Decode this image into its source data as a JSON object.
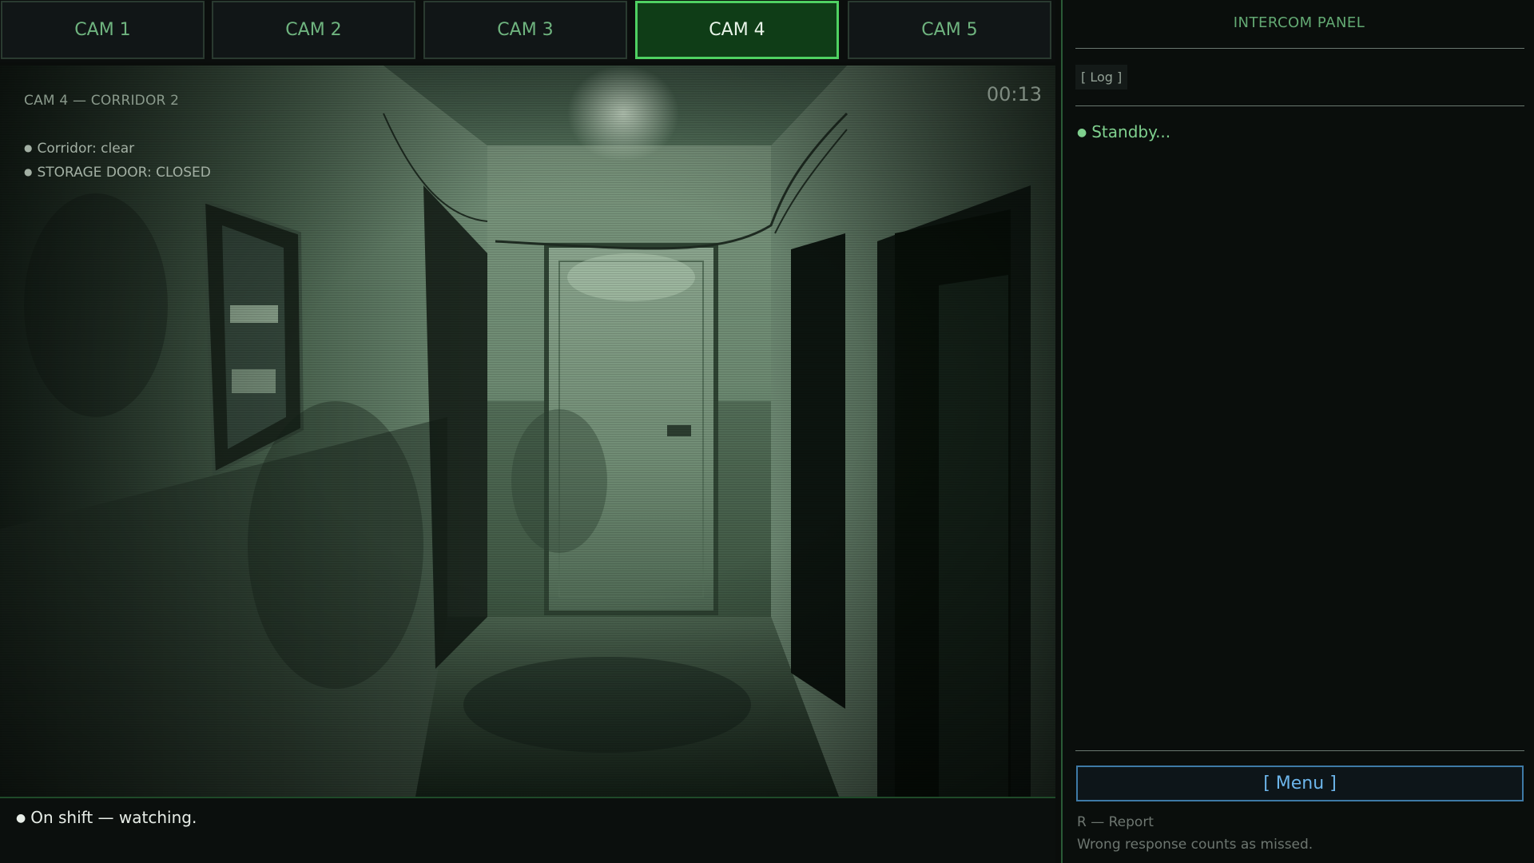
{
  "cameras": [
    {
      "label": "CAM 1",
      "active": false
    },
    {
      "label": "CAM 2",
      "active": false
    },
    {
      "label": "CAM 3",
      "active": false
    },
    {
      "label": "CAM 4",
      "active": true
    },
    {
      "label": "CAM 5",
      "active": false
    }
  ],
  "feed": {
    "title": "CAM 4 — CORRIDOR 2",
    "timestamp": "00:13",
    "status_lines": [
      "Corridor: clear",
      "STORAGE DOOR: CLOSED"
    ]
  },
  "bottom_status": "On shift — watching.",
  "panel": {
    "title": "INTERCOM PANEL",
    "log_label": "[ Log ]",
    "message": "Standby...",
    "menu_label": "[ Menu ]",
    "hint_key": "R — Report",
    "hint_note": "Wrong response counts as missed."
  },
  "colors": {
    "accent": "#4fd162",
    "active_tab_bg": "#0f3d17",
    "menu_accent": "#6cb5ea",
    "status_green": "#7fd08e"
  }
}
